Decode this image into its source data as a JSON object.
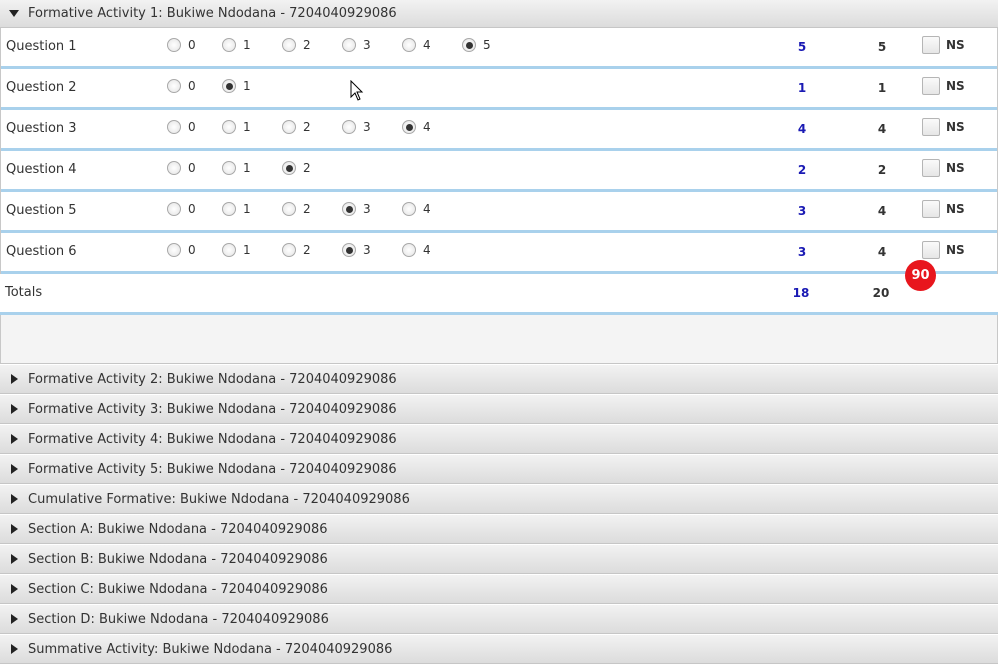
{
  "expanded_pane": {
    "title": "Formative Activity 1: Bukiwe Ndodana - 7204040929086",
    "questions": [
      {
        "label": "Question 1",
        "options": [
          "0",
          "1",
          "2",
          "3",
          "4",
          "5"
        ],
        "selected": 5,
        "score": "5",
        "max": "5",
        "ns_label": "NS"
      },
      {
        "label": "Question 2",
        "options": [
          "0",
          "1"
        ],
        "selected": 1,
        "score": "1",
        "max": "1",
        "ns_label": "NS"
      },
      {
        "label": "Question 3",
        "options": [
          "0",
          "1",
          "2",
          "3",
          "4"
        ],
        "selected": 4,
        "score": "4",
        "max": "4",
        "ns_label": "NS"
      },
      {
        "label": "Question 4",
        "options": [
          "0",
          "1",
          "2"
        ],
        "selected": 2,
        "score": "2",
        "max": "2",
        "ns_label": "NS"
      },
      {
        "label": "Question 5",
        "options": [
          "0",
          "1",
          "2",
          "3",
          "4"
        ],
        "selected": 3,
        "score": "3",
        "max": "4",
        "ns_label": "NS"
      },
      {
        "label": "Question 6",
        "options": [
          "0",
          "1",
          "2",
          "3",
          "4"
        ],
        "selected": 3,
        "score": "3",
        "max": "4",
        "ns_label": "NS"
      }
    ],
    "totals": {
      "label": "Totals",
      "score": "18",
      "max": "20"
    },
    "percent_badge": "90"
  },
  "collapsed_panes": [
    "Formative Activity 2: Bukiwe Ndodana - 7204040929086",
    "Formative Activity 3: Bukiwe Ndodana - 7204040929086",
    "Formative Activity 4: Bukiwe Ndodana - 7204040929086",
    "Formative Activity 5: Bukiwe Ndodana - 7204040929086",
    "Cumulative Formative: Bukiwe Ndodana - 7204040929086",
    "Section A: Bukiwe Ndodana - 7204040929086",
    "Section B: Bukiwe Ndodana - 7204040929086",
    "Section C: Bukiwe Ndodana - 7204040929086",
    "Section D: Bukiwe Ndodana - 7204040929086",
    "Summative Activity: Bukiwe Ndodana - 7204040929086"
  ],
  "colors": {
    "score_blue": "#1a1ab4",
    "badge_red": "#e8161d",
    "row_divider": "#a9d1ec"
  }
}
